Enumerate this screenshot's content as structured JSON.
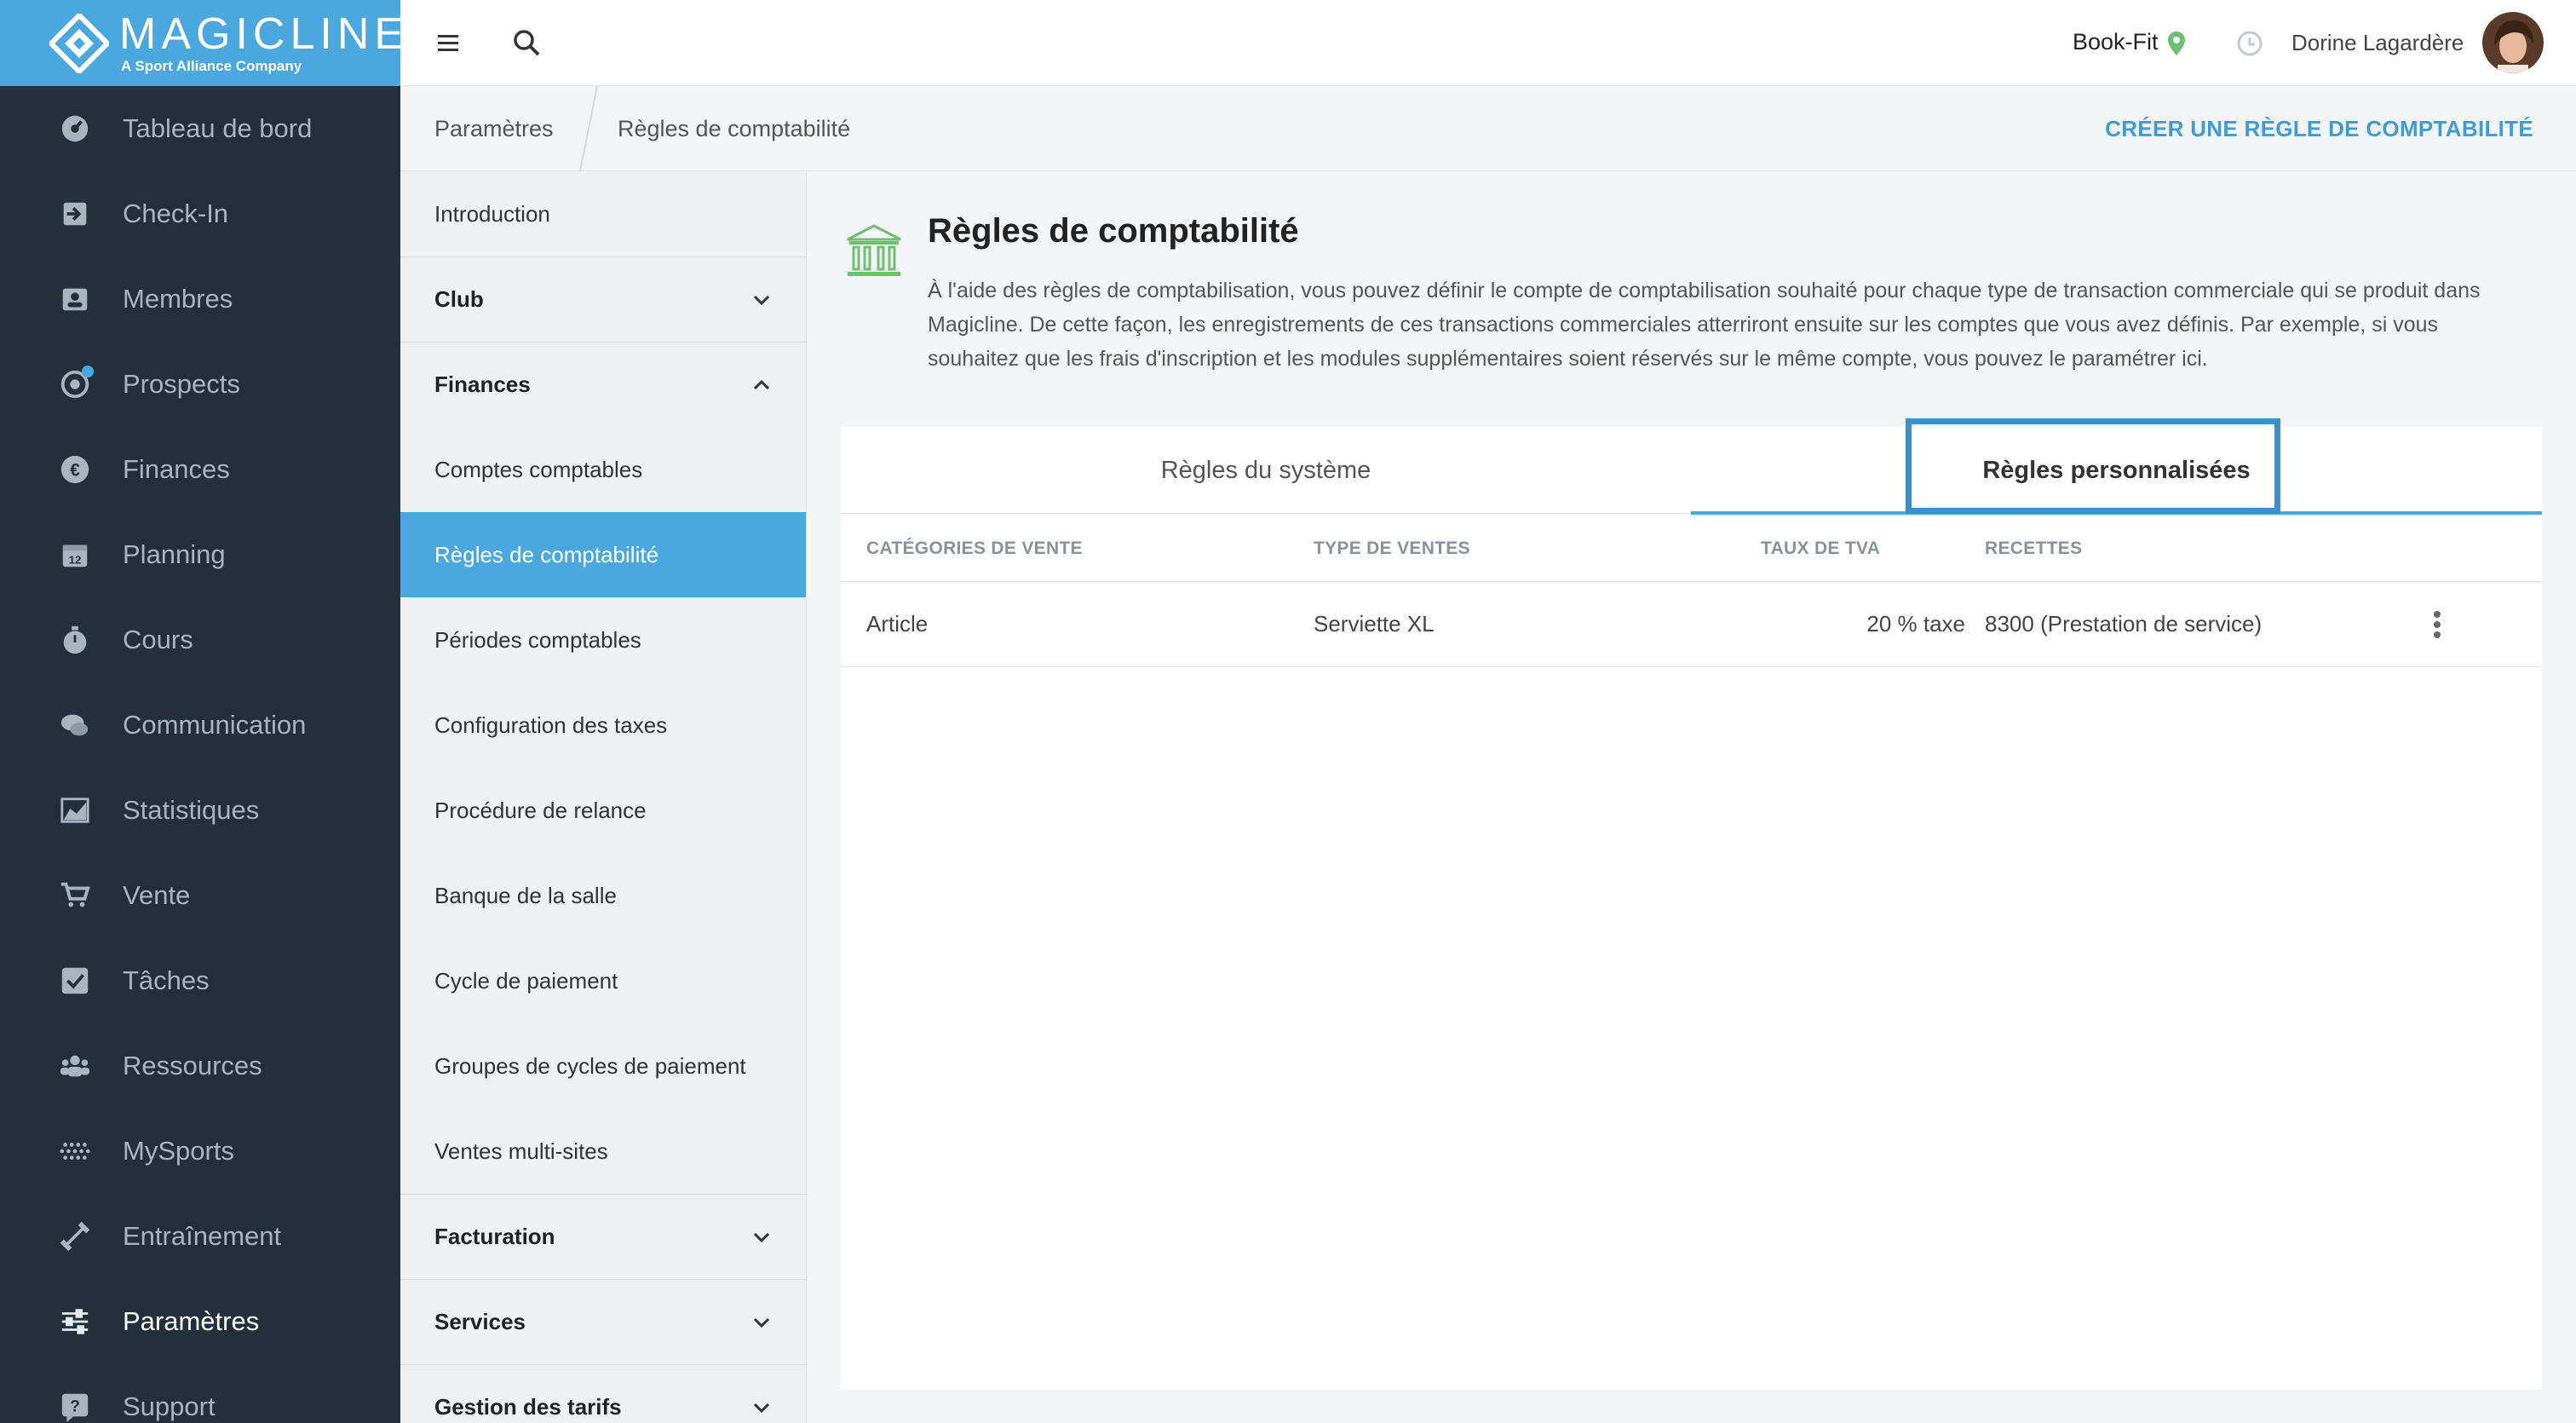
{
  "brand": {
    "name": "MAGICLINE",
    "tagline": "A Sport Alliance Company"
  },
  "nav": [
    {
      "label": "Tableau de bord",
      "icon": "dashboard-icon"
    },
    {
      "label": "Check-In",
      "icon": "check-in-icon"
    },
    {
      "label": "Membres",
      "icon": "members-icon"
    },
    {
      "label": "Prospects",
      "icon": "prospects-icon"
    },
    {
      "label": "Finances",
      "icon": "euro-icon"
    },
    {
      "label": "Planning",
      "icon": "calendar-icon"
    },
    {
      "label": "Cours",
      "icon": "stopwatch-icon"
    },
    {
      "label": "Communication",
      "icon": "chat-icon"
    },
    {
      "label": "Statistiques",
      "icon": "chart-icon"
    },
    {
      "label": "Vente",
      "icon": "cart-icon"
    },
    {
      "label": "Tâches",
      "icon": "checkbox-icon"
    },
    {
      "label": "Ressources",
      "icon": "people-icon"
    },
    {
      "label": "MySports",
      "icon": "dots-grid-icon"
    },
    {
      "label": "Entraînement",
      "icon": "dumbbell-icon"
    },
    {
      "label": "Paramètres",
      "icon": "sliders-icon"
    },
    {
      "label": "Support",
      "icon": "help-icon"
    }
  ],
  "topbar": {
    "club": "Book-Fit",
    "user": "Dorine Lagardère"
  },
  "breadcrumb": {
    "parent": "Paramètres",
    "current": "Règles de comptabilité"
  },
  "action": {
    "create_label": "CRÉER UNE RÈGLE DE COMPTABILITÉ"
  },
  "submenu": {
    "intro": "Introduction",
    "club": "Club",
    "finances": "Finances",
    "finance_items": [
      "Comptes comptables",
      "Règles de comptabilité",
      "Périodes comptables",
      "Configuration des taxes",
      "Procédure de relance",
      "Banque de la salle",
      "Cycle de paiement",
      "Groupes de cycles de paiement",
      "Ventes multi-sites"
    ],
    "facturation": "Facturation",
    "services": "Services",
    "tarifs": "Gestion des tarifs"
  },
  "page": {
    "title": "Règles de comptabilité",
    "description": "À l'aide des règles de comptabilisation, vous pouvez définir le compte de comptabilisation souhaité pour chaque type de transaction commerciale qui se produit dans Magicline. De cette façon, les enregistrements de ces transactions commerciales atterriront ensuite sur les comptes que vous avez définis. Par exemple, si vous souhaitez que les frais d'inscription et les modules supplémentaires soient réservés sur le même compte, vous pouvez le paramétrer ici."
  },
  "tabs": {
    "system": "Règles du système",
    "custom": "Règles personnalisées"
  },
  "table": {
    "headers": {
      "category": "CATÉGORIES DE VENTE",
      "type": "TYPE DE VENTES",
      "vat": "TAUX DE TVA",
      "revenue": "RECETTES"
    },
    "rows": [
      {
        "category": "Article",
        "type": "Serviette XL",
        "vat": "20 % taxe",
        "revenue": "8300 (Prestation de service)"
      }
    ]
  },
  "colors": {
    "accent": "#4aa8de",
    "sidebar": "#22303b",
    "cta": "#3f9dd6",
    "highlight": "#3d8fc7",
    "bank_icon": "#6cc070"
  }
}
